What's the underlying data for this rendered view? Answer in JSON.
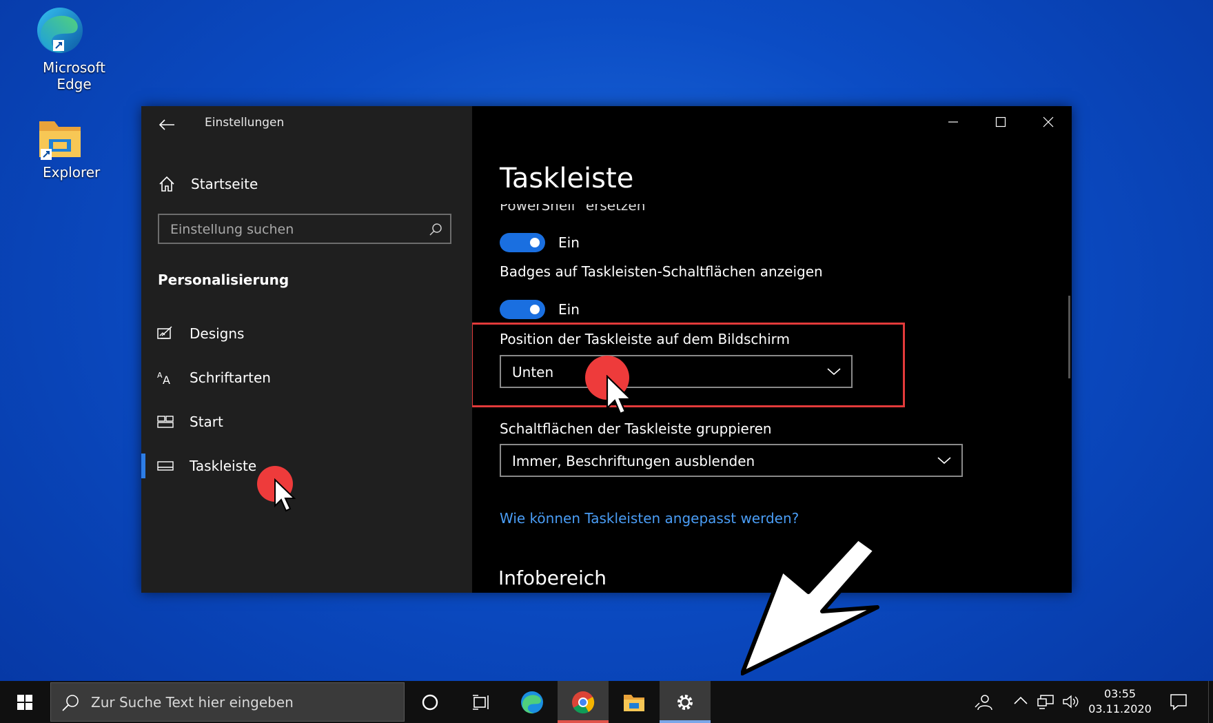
{
  "desktop": {
    "icons": [
      {
        "label": "Microsoft Edge",
        "icon": "edge-icon"
      },
      {
        "label": "Explorer",
        "icon": "folder-icon"
      }
    ]
  },
  "window": {
    "title": "Einstellungen",
    "sidebar": {
      "home_label": "Startseite",
      "search_placeholder": "Einstellung suchen",
      "section_title": "Personalisierung",
      "items": [
        {
          "label": "Designs",
          "icon": "designs-icon"
        },
        {
          "label": "Schriftarten",
          "icon": "fonts-icon"
        },
        {
          "label": "Start",
          "icon": "start-icon"
        },
        {
          "label": "Taskleiste",
          "icon": "taskbar-icon",
          "active": true
        }
      ]
    },
    "content": {
      "page_title": "Taskleiste",
      "cut_label": "PowerShell\" ersetzen",
      "toggle1_state": "Ein",
      "badges_label": "Badges auf Taskleisten-Schaltflächen anzeigen",
      "toggle2_state": "Ein",
      "position_label": "Position der Taskleiste auf dem Bildschirm",
      "position_value": "Unten",
      "group_label": "Schaltflächen der Taskleiste gruppieren",
      "group_value": "Immer, Beschriftungen ausblenden",
      "help_link": "Wie können Taskleisten angepasst werden?",
      "infobereich_title": "Infobereich"
    }
  },
  "taskbar": {
    "search_placeholder": "Zur Suche Text hier eingeben",
    "time": "03:55",
    "date": "03.11.2020",
    "apps": [
      "cortana-icon",
      "task-view-icon",
      "edge-icon",
      "chrome-icon",
      "explorer-icon",
      "settings-icon"
    ]
  },
  "colors": {
    "accent": "#1a6fe0",
    "highlight": "#e23a3a",
    "link": "#4a9df5"
  }
}
